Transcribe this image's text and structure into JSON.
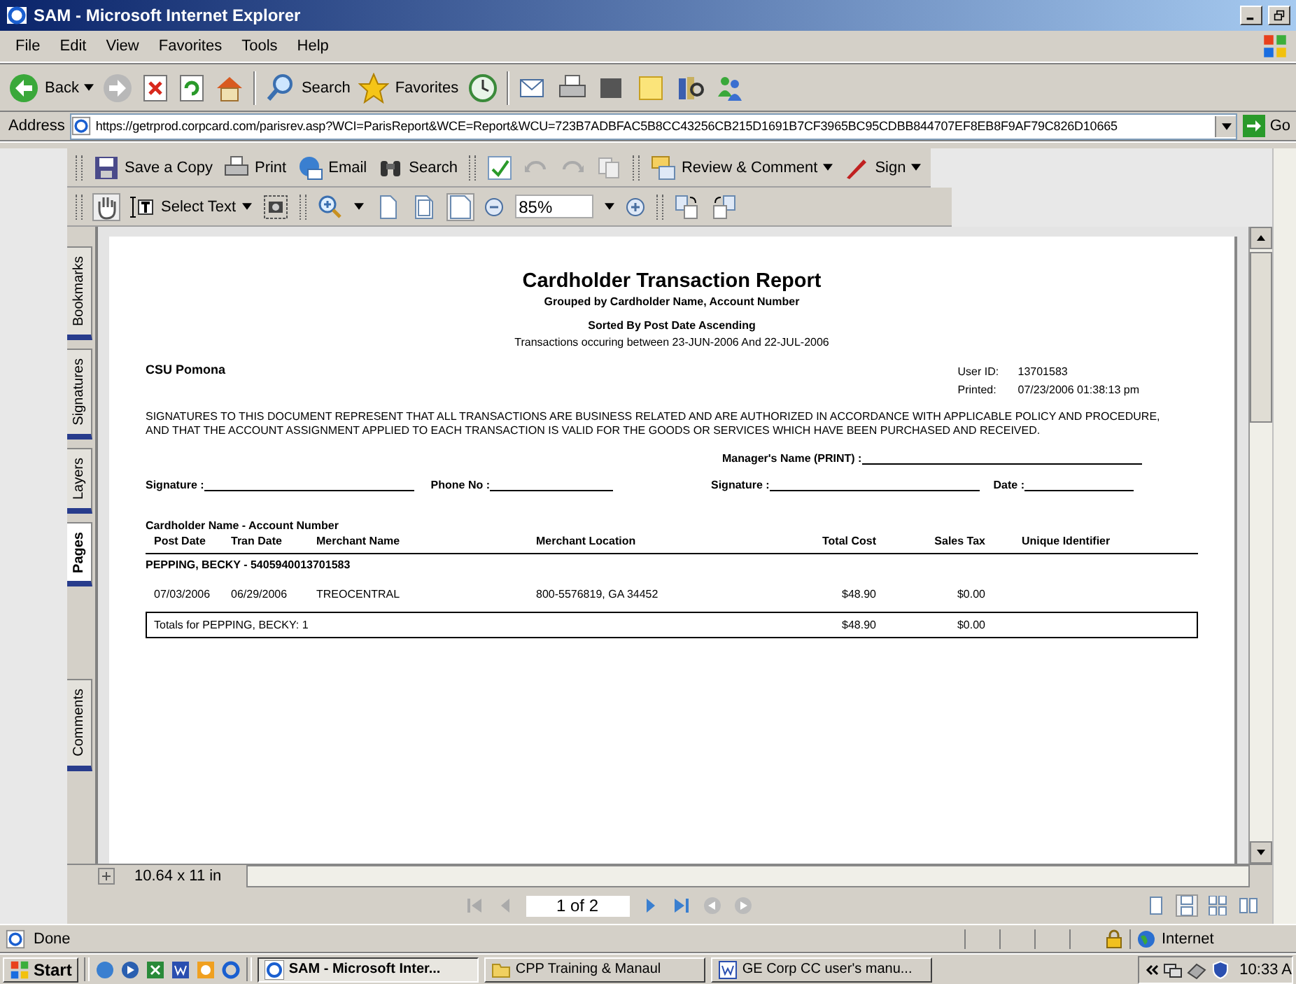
{
  "window": {
    "title": "SAM - Microsoft Internet Explorer"
  },
  "menu": [
    "File",
    "Edit",
    "View",
    "Favorites",
    "Tools",
    "Help"
  ],
  "toolbar": {
    "back": "Back",
    "search": "Search",
    "favorites": "Favorites"
  },
  "address": {
    "label": "Address",
    "url": "https://getrprod.corpcard.com/parisrev.asp?WCI=ParisReport&WCE=Report&WCU=723B7ADBFAC5B8CC43256CB215D1691B7CF3965BC95CDBB844707EF8EB8F9AF79C826D10665",
    "go": "Go"
  },
  "reader_toolbar": {
    "save": "Save a Copy",
    "print": "Print",
    "email": "Email",
    "search": "Search",
    "review": "Review & Comment",
    "sign": "Sign",
    "select_text": "Select Text",
    "zoom": "85%"
  },
  "side_tabs": [
    {
      "label": "Bookmarks",
      "selected": false
    },
    {
      "label": "Signatures",
      "selected": false
    },
    {
      "label": "Layers",
      "selected": false
    },
    {
      "label": "Pages",
      "selected": true
    },
    {
      "label": "Comments",
      "selected": false
    }
  ],
  "report": {
    "title": "Cardholder Transaction Report",
    "subtitle": "Grouped by Cardholder Name, Account Number",
    "sort": "Sorted By Post Date Ascending",
    "range": "Transactions occuring between 23-JUN-2006 And 22-JUL-2006",
    "org": "CSU Pomona",
    "meta": [
      {
        "label": "User ID:",
        "value": "13701583"
      },
      {
        "label": "Printed:",
        "value": "07/23/2006 01:38:13 pm"
      }
    ],
    "statement": "SIGNATURES TO THIS DOCUMENT REPRESENT THAT ALL TRANSACTIONS ARE BUSINESS RELATED AND ARE AUTHORIZED IN ACCORDANCE WITH APPLICABLE POLICY AND PROCEDURE, AND THAT THE ACCOUNT ASSIGNMENT APPLIED TO EACH TRANSACTION IS VALID FOR THE GOODS OR SERVICES WHICH HAVE BEEN PURCHASED AND RECEIVED.",
    "manager_name": "Manager's Name (PRINT) :",
    "signature_fields": [
      "Signature :",
      "Phone No :",
      "Signature :",
      "Date :"
    ],
    "group_label": "Cardholder Name - Account Number",
    "columns": [
      "Post Date",
      "Tran Date",
      "Merchant Name",
      "Merchant Location",
      "Total Cost",
      "Sales Tax",
      "Unique Identifier"
    ],
    "groups": [
      {
        "header": "PEPPING, BECKY - 5405940013701583",
        "rows": [
          [
            "07/03/2006",
            "06/29/2006",
            "TREOCENTRAL",
            "800-5576819, GA 34452",
            "$48.90",
            "$0.00"
          ]
        ],
        "totals": {
          "label": "Totals for PEPPING, BECKY: 1",
          "total": "$48.90",
          "tax": "$0.00"
        }
      }
    ]
  },
  "page_size": "10.64 x 11 in",
  "page_nav": "1 of 2",
  "status": {
    "text": "Done",
    "zone": "Internet"
  },
  "taskbar": {
    "start": "Start",
    "tasks": [
      {
        "label": "SAM - Microsoft Inter...",
        "selected": true,
        "kind": "browser"
      },
      {
        "label": "CPP Training & Manaul",
        "selected": false,
        "kind": "folder"
      },
      {
        "label": "GE Corp CC user's manu...",
        "selected": false,
        "kind": "document"
      }
    ],
    "time": "10:33 A"
  }
}
